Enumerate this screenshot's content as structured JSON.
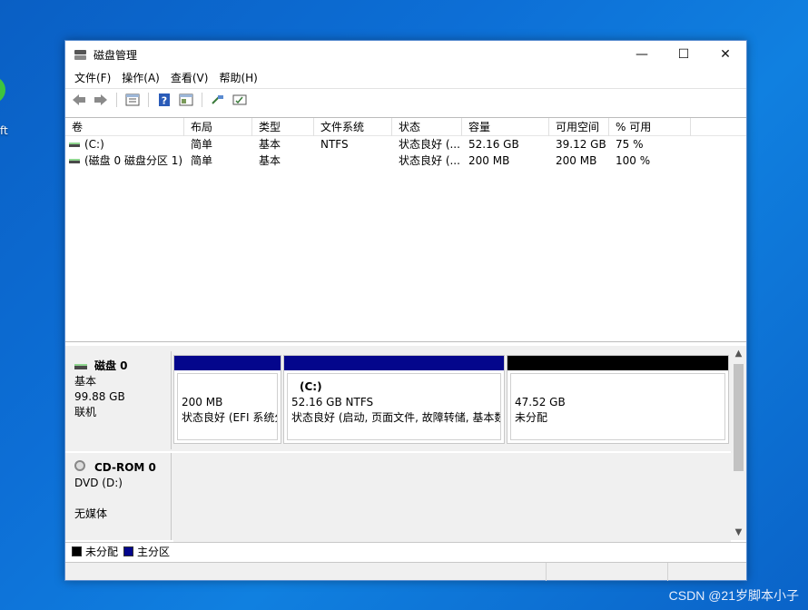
{
  "desktop": {
    "label_fragment": "ft",
    "watermark": "CSDN @21岁脚本小子"
  },
  "window": {
    "title": "磁盘管理",
    "controls": {
      "minimize": "—",
      "maximize": "☐",
      "close": "✕"
    }
  },
  "menu": [
    "文件(F)",
    "操作(A)",
    "查看(V)",
    "帮助(H)"
  ],
  "toolbar": [
    "back-icon",
    "forward-icon",
    "disk-list-icon",
    "help-icon",
    "properties-icon",
    "refresh-icon",
    "console-icon"
  ],
  "volume_list": {
    "columns": [
      "卷",
      "布局",
      "类型",
      "文件系统",
      "状态",
      "容量",
      "可用空间",
      "% 可用"
    ],
    "rows": [
      [
        "(C:)",
        "简单",
        "基本",
        "NTFS",
        "状态良好 (...",
        "52.16 GB",
        "39.12 GB",
        "75 %"
      ],
      [
        "(磁盘 0 磁盘分区 1)",
        "简单",
        "基本",
        "",
        "状态良好 (...",
        "200 MB",
        "200 MB",
        "100 %"
      ]
    ]
  },
  "disks": [
    {
      "name": "磁盘 0",
      "type": "基本",
      "size": "99.88 GB",
      "status": "联机",
      "partitions": [
        {
          "title": "",
          "size": "200 MB",
          "status": "状态良好 (EFI 系统分",
          "kind": "primary"
        },
        {
          "title": "(C:)",
          "size": "52.16 GB NTFS",
          "status": "状态良好 (启动, 页面文件, 故障转储, 基本数",
          "kind": "primary"
        },
        {
          "title": "",
          "size": "47.52 GB",
          "status": "未分配",
          "kind": "unalloc"
        }
      ]
    },
    {
      "name": "CD-ROM 0",
      "type": "DVD (D:)",
      "status": "无媒体"
    }
  ],
  "legend": [
    {
      "label": "未分配",
      "color": "#000000"
    },
    {
      "label": "主分区",
      "color": "#04068c"
    }
  ]
}
